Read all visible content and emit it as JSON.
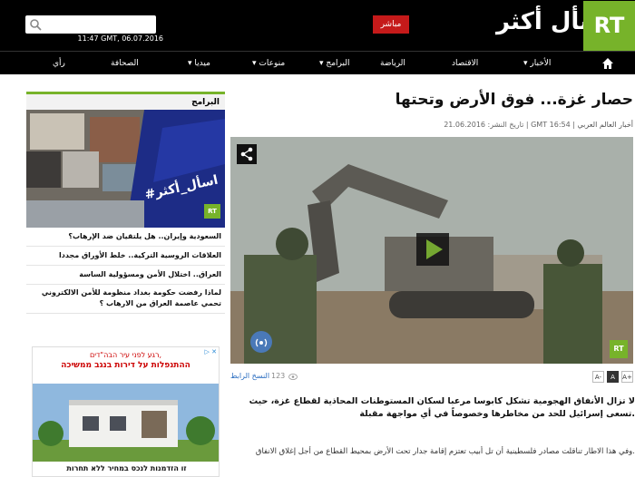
{
  "header": {
    "date": "11:47 GMT, 06.07.2016",
    "live_label": "مباشر",
    "brand": "أسأل أكثر",
    "logo": "RT",
    "search_placeholder": ""
  },
  "nav": {
    "items": [
      "الأخبار",
      "الاقتصاد",
      "الرياضة",
      "البرامج",
      "منوعات",
      "ميديا",
      "الصحافة",
      "رأي"
    ]
  },
  "sidebar": {
    "heading": "البرامج",
    "promo_text": "#اسأل_أكثر",
    "promo_logo": "RT",
    "items": [
      "السعودية وإيران.. هل يلتقيان ضد الإرهاب؟",
      "العلاقات الروسية التركية.. خلط الأوراق مجددا",
      "العراق.. اختلال الأمن ومسؤولية الساسة",
      "لماذا رفضت حكومة بغداد منظومة  للأمن الالكتروني تحمي عاصمة العراق من الارهاب ؟"
    ]
  },
  "ad": {
    "top_line": "רגע לפני עיר הבה\"דים,",
    "title_line": "ההתנפלות על דירות בנגב ממשיכה",
    "bottom_line": "זו הזדמנות לנכס במחיר ללא תחרות",
    "close": "▷ ✕"
  },
  "article": {
    "title": "حصار غزة... فوق الأرض وتحتها",
    "meta_prefix": "تاريخ النشر: 21.06.2016 | GMT 16:54 |",
    "meta_source": "أخبار العالم العربي",
    "video_logo": "RT",
    "views": "123",
    "short_link": "النسخ الرابط",
    "font_sizes": [
      "A+",
      "A",
      "A-"
    ],
    "lead": "لا تزال الأنفاق الهجومية تشكل كابوسا مرعبا لسكان المستوطنات المحاذية لقطاع غزة، حيث تسعى إسرائيل للحد من مخاطرها وخصوصاً في أي مواجهة مقبلة.",
    "body": "وفي هذا الاطار تناقلت مصادر فلسطينية أن تل أبيب تعتزم إقامة جدار تحت الأرض بمحيط القطاع من أجل إغلاق الانفاق."
  }
}
